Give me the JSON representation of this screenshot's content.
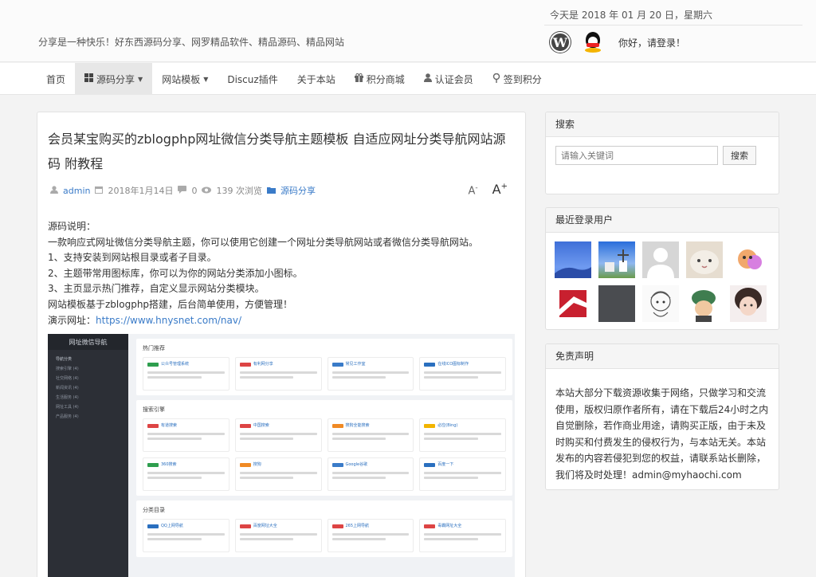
{
  "header": {
    "date": "今天是 2018 年 01 月 20 日，星期六",
    "slogan": "分享是一种快乐！好东西源码分享、网罗精品软件、精品源码、精品网站",
    "wp_letter": "W",
    "login_text": "你好，请登录！"
  },
  "nav": {
    "items": [
      {
        "label": "首页"
      },
      {
        "label": "源码分享",
        "icon": "grid-icon"
      },
      {
        "label": "网站模板"
      },
      {
        "label": "Discuz插件"
      },
      {
        "label": "关于本站"
      },
      {
        "label": "积分商城",
        "icon": "gift-icon"
      },
      {
        "label": "认证会员",
        "icon": "user-icon"
      },
      {
        "label": "签到积分",
        "icon": "pin-icon"
      }
    ],
    "active_index": 1
  },
  "article": {
    "title": "会员某宝购买的zblogphp网址微信分类导航主题模板 自适应网址分类导航网站源码 附教程",
    "meta": {
      "author": "admin",
      "date": "2018年1月14日",
      "comments": "0",
      "views": "139 次浏览",
      "category": "源码分享"
    },
    "font_small": "A",
    "font_small_sup": "-",
    "font_big": "A",
    "font_big_sup": "+",
    "body": [
      "源码说明：",
      "一款响应式网址微信分类导航主题，你可以使用它创建一个网址分类导航网站或者微信分类导航网站。",
      "1、支持安装到网站根目录或者子目录。",
      "2、主题带常用图标库，你可以为你的网站分类添加小图标。",
      "3、主页显示热门推荐，自定义显示网站分类模块。",
      "网站模板基于zblogphp搭建，后台简单使用，方便管理！"
    ],
    "demo_label": "演示网址：",
    "demo_url": "https://www.hnysnet.com/nav/"
  },
  "preview": {
    "brand": "网址微信导航",
    "menu": [
      "导航分类",
      "搜索引擎 (4)",
      "社交网络 (4)",
      "新闻资讯 (4)",
      "生活服务 (4)",
      "网址工具 (4)",
      "产品服务 (4)"
    ],
    "sections": [
      {
        "title": "热门推荐",
        "cards": [
          "公众号管理系统",
          "有利网分享",
          "常见工作室",
          "在线ICO图标制作"
        ]
      },
      {
        "title": "搜索引擎",
        "cards": [
          "有道搜索",
          "中国搜索",
          "搜狗全能搜索",
          "必应(Bing)"
        ]
      },
      {
        "title": "",
        "cards": [
          "360搜索",
          "搜狗",
          "Google谷歌",
          "百度一下"
        ]
      },
      {
        "title": "分类目录",
        "cards": [
          "QQ上网导航",
          "百度网址大全",
          "265上网导航",
          "毒霸网址大全"
        ]
      }
    ],
    "colors": [
      "#2e9e4e",
      "#d44",
      "#3a7bc8",
      "#2a6fbf"
    ]
  },
  "sidebar": {
    "search": {
      "title": "搜索",
      "placeholder": "请输入关键词",
      "button": "搜索"
    },
    "users": {
      "title": "最近登录用户",
      "avatars": [
        "blue-sky-avatar",
        "windmill-avatar",
        "default-avatar",
        "cat-avatar",
        "cartoon-avatar",
        "logo-avatar",
        "dark-avatar",
        "sketch-avatar",
        "green-hat-avatar",
        "girl-avatar"
      ]
    },
    "disclaimer": {
      "title": "免责声明",
      "text": "本站大部分下载资源收集于网络，只做学习和交流使用，版权归原作者所有，请在下载后24小时之内自觉删除，若作商业用途，请购买正版，由于未及时购买和付费发生的侵权行为，与本站无关。本站发布的内容若侵犯到您的权益，请联系站长删除，我们将及时处理！admin@myhaochi.com"
    }
  }
}
